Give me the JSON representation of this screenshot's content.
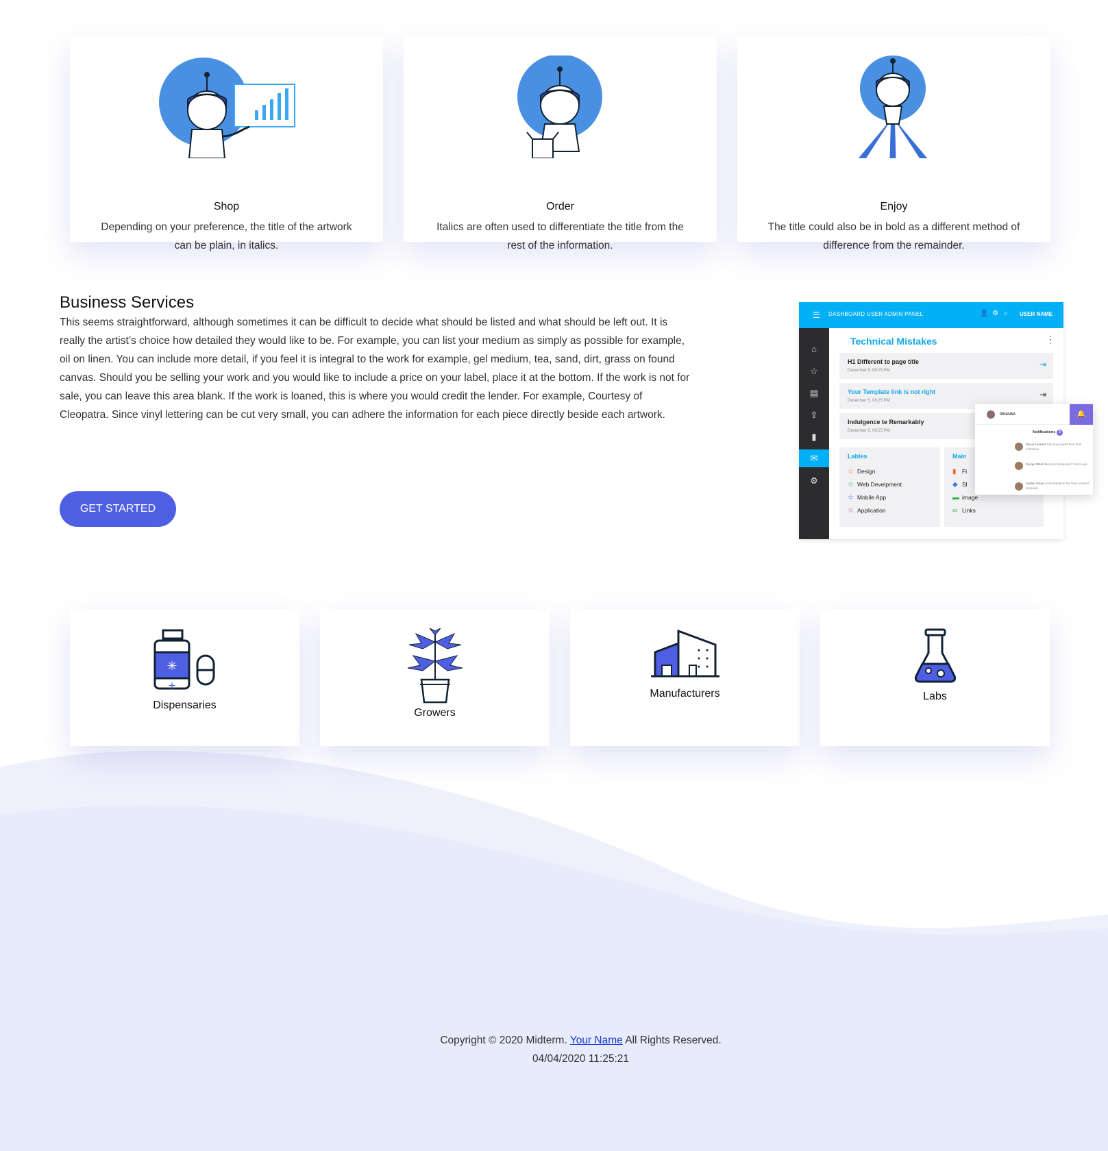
{
  "features": [
    {
      "icon": "robot-chart-icon",
      "title": "Shop",
      "text": "Depending on your preference, the title of the artwork can be plain, in italics."
    },
    {
      "icon": "robot-box-icon",
      "title": "Order",
      "text": "Italics are often used to differentiate the title from the rest of the information."
    },
    {
      "icon": "robot-light-icon",
      "title": "Enjoy",
      "text": "The title could also be in bold as a different method of difference from the remainder."
    }
  ],
  "business": {
    "heading": "Business Services",
    "body": "This seems straightforward, although sometimes it can be difficult to decide what should be listed and what should be left out. It is really the artist’s choice how detailed they would like to be. For example, you can list your medium as simply as possible for example, oil on linen. You can include more detail, if you feel it is integral to the work for example, gel medium, tea, sand, dirt, grass on found canvas. Should you be selling your work and you would like to include a price on your label, place it at the bottom. If the work is not for sale, you can leave this area blank. If the work is loaned, this is where you would credit the lender. For example, Courtesy of Cleopatra. Since vinyl lettering can be cut very small, you can adhere the information for each piece directly beside each artwork.",
    "button_label": "GET STARTED"
  },
  "dashboard": {
    "topbar_title": "DASHBOARD USER ADMIN PANEL",
    "user_label": "USER NAME",
    "section_title": "Technical Mistakes",
    "rows": [
      {
        "title": "H1 Different to page title",
        "date": "December 5, 08:25 PM"
      },
      {
        "title": "Your Template link is not right",
        "date": "December 5, 08:25 PM"
      },
      {
        "title": "Indulgence te Remarkably",
        "date": "December 5, 08:25 PM"
      }
    ],
    "labels_heading": "Lables",
    "labels": [
      "Design",
      "Web Develpment",
      "Mobile App",
      "Application"
    ],
    "main_heading": "Main",
    "main_items": [
      "Fi",
      "Sl",
      "image",
      "Links"
    ],
    "notif_user": "RIHANNA",
    "notif_title": "Notifications",
    "notif_count": "3",
    "notif_items": [
      {
        "name": "Oscar Linnete",
        "text": "has now payed their final milestone."
      },
      {
        "name": "Kanye West",
        "text": "liked your proposal 2 hours ago."
      },
      {
        "name": "Amber Rose",
        "text": "commented on the final contract proposal."
      }
    ]
  },
  "categories": [
    {
      "icon": "medicine-bottle-icon",
      "label": "Dispensaries"
    },
    {
      "icon": "potted-plant-icon",
      "label": "Growers"
    },
    {
      "icon": "factory-icon",
      "label": "Manufacturers"
    },
    {
      "icon": "flask-icon",
      "label": "Labs"
    }
  ],
  "footer": {
    "copyright_prefix": "Copyright © 2020 Midterm.",
    "link_text": "Your Name",
    "copyright_suffix": "All Rights Reserved.",
    "timestamp": "04/04/2020 11:25:21"
  },
  "colors": {
    "accent": "#4f5fe4",
    "dashboard_blue": "#04b0f5",
    "wave": "#e8ebfb"
  }
}
